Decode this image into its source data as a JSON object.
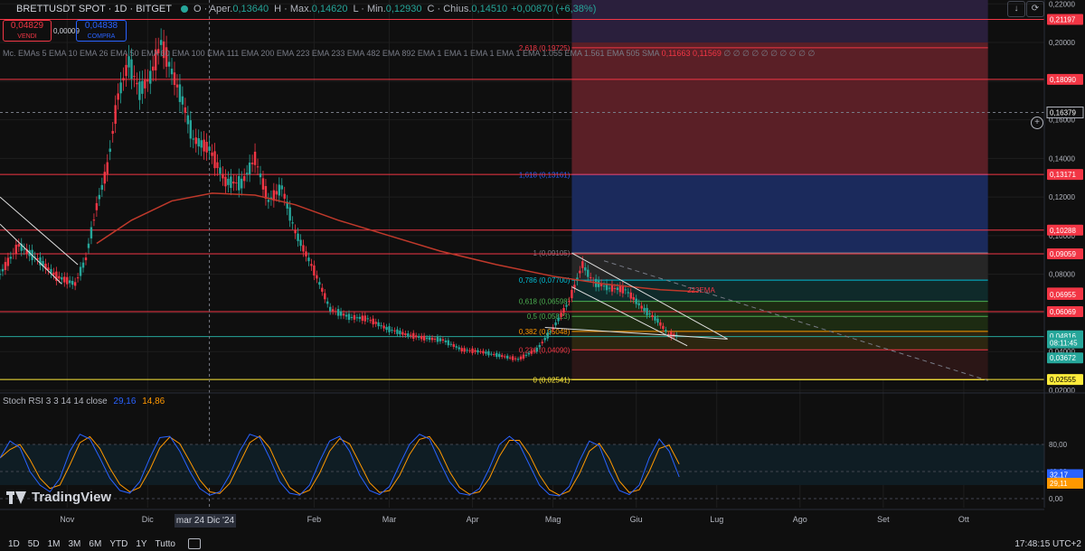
{
  "header": {
    "symbol": "BRETTUSDT SPOT · 1D · BITGET",
    "open_label": "O · Aper.",
    "open": "0,13640",
    "high_label": "H · Max.",
    "high": "0,14620",
    "low_label": "L · Min.",
    "low": "0,12930",
    "close_label": "C · Chius.",
    "close": "0,14510",
    "change": "+0,00870 (+6,38%)"
  },
  "trade": {
    "sell_price": "0,04829",
    "sell_label": "VENDI",
    "buy_price": "0,04838",
    "buy_label": "COMPRA",
    "spread": "0,00009"
  },
  "indicators": {
    "short": "Mc.",
    "ema_list": "EMAs 5 EMA 10 EMA 26 EMA 50 EMA 60 EMA 100 EMA 111 EMA 200 EMA 223 EMA 233 EMA 482 EMA 892 EMA 1 EMA 1 EMA 1 EMA 1 EMA 1.055 EMA 1.561 EMA 505 SMA",
    "ema_prefix": "∅ ∅ ∅ ∅ ∅ ∅ ∅ ∅ ∅ ∅",
    "ema_value_a": "0,11663",
    "ema_value_b": "0,11569",
    "ema_tail": "∅ ∅ ∅ ∅ ∅ ∅ ∅ ∅ ∅ ∅"
  },
  "rsi": {
    "name": "Stoch RSI 3 3 14 14 close",
    "k": "29,16",
    "d": "14,86"
  },
  "branding": {
    "logo_text": "TradingView"
  },
  "crosshair": {
    "date": "mar 24 Dic '24"
  },
  "timeframes": [
    "1D",
    "5D",
    "1M",
    "3M",
    "6M",
    "YTD",
    "1Y",
    "Tutto"
  ],
  "footer": {
    "clock": "17:48:15 UTC+2"
  },
  "colors": {
    "up": "#26a69a",
    "down": "#f23645",
    "level": "#f23645",
    "fib_teal": "#00bcd4",
    "fib_green": "#4caf50",
    "fib_yellow": "#ffeb3b",
    "zone_red": "#5a1f26",
    "zone_blue": "#1b2a5c",
    "zone_gray": "#2a2a2a"
  },
  "chart_data": {
    "type": "candlestick",
    "symbol": "BRETTUSDT",
    "timeframe": "1D",
    "ylim": [
      0.02,
      0.222
    ],
    "x_range": [
      "2024-10-07",
      "2025-10-31"
    ],
    "scale": "linear",
    "price_ticks": [
      "0,22000",
      "0,20000",
      "0,18000",
      "0,16000",
      "0,14000",
      "0,12000",
      "0,10000",
      "0,08000",
      "0,06000",
      "0,04000",
      "0,02000"
    ],
    "price_tick_values": [
      0.22,
      0.2,
      0.18,
      0.16,
      0.14,
      0.12,
      0.1,
      0.08,
      0.06,
      0.04,
      0.02
    ],
    "time_labels": [
      "Nov",
      "Dic",
      "Feb",
      "Mar",
      "Apr",
      "Mag",
      "Giu",
      "Lug",
      "Ago",
      "Set",
      "Ott"
    ],
    "time_label_dates": [
      "2024-11-01",
      "2024-12-01",
      "2025-02-01",
      "2025-03-01",
      "2025-04-01",
      "2025-05-01",
      "2025-06-01",
      "2025-07-01",
      "2025-08-01",
      "2025-09-01",
      "2025-10-01"
    ],
    "crosshair_date": "2024-12-24",
    "current_price": "0,16379",
    "current_price_value": 0.16379,
    "series_close": [
      [
        "2024-10-07",
        0.08
      ],
      [
        "2024-10-14",
        0.095
      ],
      [
        "2024-10-21",
        0.088
      ],
      [
        "2024-10-28",
        0.079
      ],
      [
        "2024-11-04",
        0.075
      ],
      [
        "2024-11-08",
        0.088
      ],
      [
        "2024-11-12",
        0.115
      ],
      [
        "2024-11-16",
        0.135
      ],
      [
        "2024-11-20",
        0.172
      ],
      [
        "2024-11-24",
        0.19
      ],
      [
        "2024-11-28",
        0.175
      ],
      [
        "2024-12-02",
        0.182
      ],
      [
        "2024-12-06",
        0.2
      ],
      [
        "2024-12-10",
        0.185
      ],
      [
        "2024-12-14",
        0.17
      ],
      [
        "2024-12-18",
        0.15
      ],
      [
        "2024-12-24",
        0.145
      ],
      [
        "2024-12-30",
        0.128
      ],
      [
        "2025-01-05",
        0.127
      ],
      [
        "2025-01-10",
        0.14
      ],
      [
        "2025-01-15",
        0.118
      ],
      [
        "2025-01-20",
        0.125
      ],
      [
        "2025-01-25",
        0.102
      ],
      [
        "2025-02-01",
        0.082
      ],
      [
        "2025-02-07",
        0.062
      ],
      [
        "2025-02-14",
        0.058
      ],
      [
        "2025-02-21",
        0.057
      ],
      [
        "2025-02-28",
        0.052
      ],
      [
        "2025-03-07",
        0.049
      ],
      [
        "2025-03-14",
        0.047
      ],
      [
        "2025-03-21",
        0.046
      ],
      [
        "2025-03-28",
        0.041
      ],
      [
        "2025-04-04",
        0.04
      ],
      [
        "2025-04-11",
        0.038
      ],
      [
        "2025-04-18",
        0.036
      ],
      [
        "2025-04-25",
        0.041
      ],
      [
        "2025-05-01",
        0.052
      ],
      [
        "2025-05-07",
        0.066
      ],
      [
        "2025-05-12",
        0.085
      ],
      [
        "2025-05-16",
        0.076
      ],
      [
        "2025-05-22",
        0.073
      ],
      [
        "2025-05-28",
        0.072
      ],
      [
        "2025-06-03",
        0.063
      ],
      [
        "2025-06-09",
        0.056
      ],
      [
        "2025-06-13",
        0.049
      ],
      [
        "2025-06-17",
        0.048
      ]
    ],
    "ema": {
      "name": "223EMA",
      "points": [
        [
          "2024-11-12",
          0.096
        ],
        [
          "2024-11-25",
          0.108
        ],
        [
          "2024-12-10",
          0.118
        ],
        [
          "2024-12-25",
          0.122
        ],
        [
          "2025-01-10",
          0.121
        ],
        [
          "2025-01-25",
          0.116
        ],
        [
          "2025-02-10",
          0.108
        ],
        [
          "2025-03-01",
          0.1
        ],
        [
          "2025-03-20",
          0.092
        ],
        [
          "2025-04-10",
          0.085
        ],
        [
          "2025-05-01",
          0.079
        ],
        [
          "2025-05-20",
          0.075
        ],
        [
          "2025-06-10",
          0.072
        ],
        [
          "2025-06-24",
          0.071
        ]
      ]
    },
    "horizontal_levels": [
      {
        "label": "0,21197",
        "price": 0.21197
      },
      {
        "label": "0,18090",
        "price": 0.1809
      },
      {
        "label": "0,13171",
        "price": 0.13171
      },
      {
        "label": "0,10288",
        "price": 0.10288
      },
      {
        "label": "0,09059",
        "price": 0.09059
      },
      {
        "label": "0,06069",
        "price": 0.06069
      },
      {
        "label": "0,04775",
        "price": 0.04775
      }
    ],
    "fib_levels": [
      {
        "label": "2,618 (0,19725)",
        "price": 0.19725,
        "color": "#f23645"
      },
      {
        "label": "1,618 (0,13161)",
        "price": 0.13161,
        "color": "#2962ff"
      },
      {
        "label": "1 (0,09105)",
        "price": 0.09105,
        "color": "#787b86"
      },
      {
        "label": "0,786 (0,07700)",
        "price": 0.077,
        "color": "#00bcd4"
      },
      {
        "label": "0,618 (0,06598)",
        "price": 0.06598,
        "color": "#4caf50"
      },
      {
        "label": "0,5 (0,05823)",
        "price": 0.05823,
        "color": "#4caf50"
      },
      {
        "label": "0,382 (0,05048)",
        "price": 0.05048,
        "color": "#ff9800"
      },
      {
        "label": "0,236 (0,04090)",
        "price": 0.0409,
        "color": "#f23645"
      },
      {
        "label": "0 (0,02541)",
        "price": 0.02541,
        "color": "#ffeb3b"
      }
    ],
    "fib_range_dates": [
      "2025-05-08",
      "2025-10-10"
    ],
    "right_badges": [
      {
        "text": "0,07032",
        "price": 0.07032,
        "color": "#f23645"
      },
      {
        "text": "0,06955",
        "price": 0.06955,
        "color": "#f23645"
      },
      {
        "text": "0,04816",
        "price": 0.04816,
        "color": "#26a69a"
      },
      {
        "text": "08:11:45",
        "price": 0.0445,
        "color": "#26a69a"
      },
      {
        "text": "0,03672",
        "price": 0.03672,
        "color": "#26a69a"
      },
      {
        "text": "0,02555",
        "price": 0.02555,
        "color": "#ffeb3b"
      }
    ],
    "stoch_rsi": {
      "ticks": [
        "80,00",
        "40,00",
        "0,00"
      ],
      "tick_values": [
        80,
        40,
        0
      ],
      "band": [
        20,
        80
      ],
      "k_last": "32,17",
      "d_last": "29,11",
      "k_values": [
        60,
        85,
        75,
        40,
        20,
        10,
        30,
        70,
        95,
        88,
        60,
        30,
        12,
        8,
        25,
        60,
        90,
        92,
        70,
        40,
        15,
        5,
        10,
        35,
        70,
        95,
        90,
        60,
        25,
        8,
        5,
        20,
        55,
        85,
        92,
        70,
        35,
        12,
        6,
        18,
        50,
        80,
        95,
        88,
        55,
        25,
        8,
        5,
        15,
        45,
        80,
        92,
        80,
        50,
        20,
        6,
        4,
        18,
        55,
        85,
        78,
        40,
        12,
        6,
        20,
        60,
        88,
        70,
        32
      ]
    }
  }
}
